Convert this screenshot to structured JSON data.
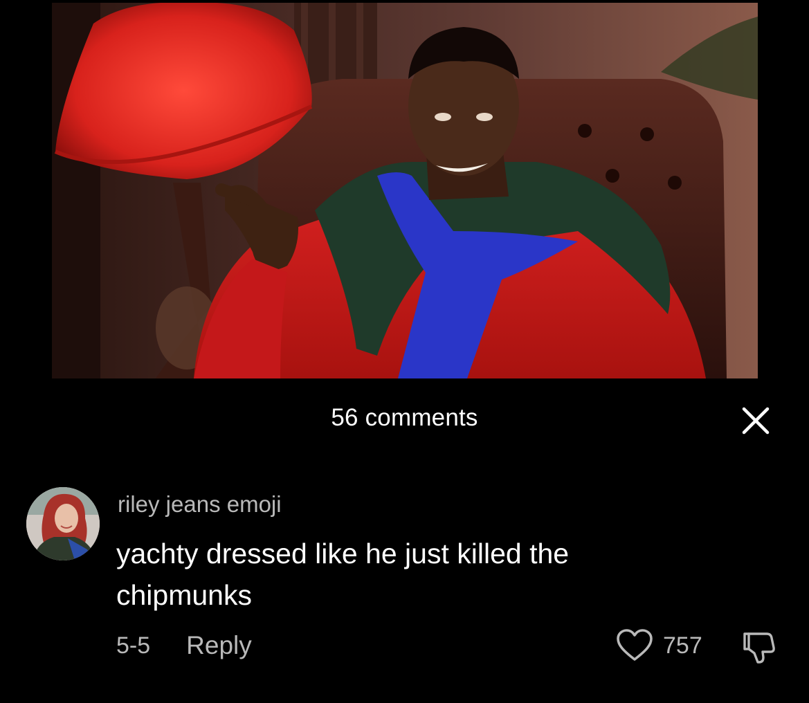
{
  "video": {
    "icon": "video-frame"
  },
  "comments": {
    "count_label": "56 comments",
    "close_icon": "close-icon"
  },
  "comment": {
    "username": "riley jeans emoji",
    "text": "yachty dressed like he just killed the chipmunks",
    "date": "5-5",
    "reply_label": "Reply",
    "like_count": "757",
    "like_icon": "heart-outline-icon",
    "dislike_icon": "thumbs-down-icon"
  },
  "colors": {
    "background": "#000000",
    "primary_text": "#ffffff",
    "secondary_text": "#b9b9b9"
  }
}
